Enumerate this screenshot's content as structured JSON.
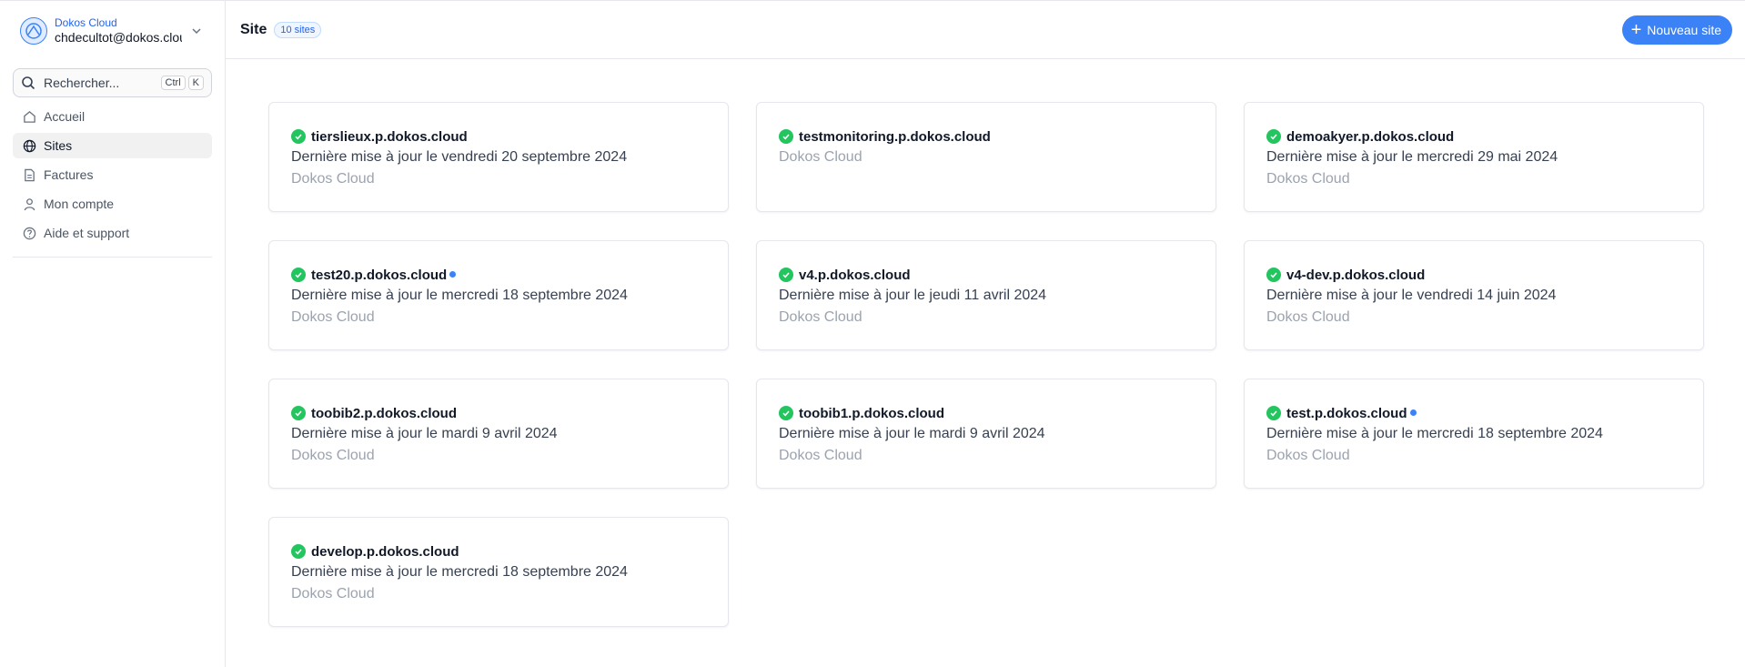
{
  "account": {
    "org": "Dokos Cloud",
    "email": "chdecultot@dokos.cloud"
  },
  "search": {
    "label": "Rechercher...",
    "kbd_ctrl": "Ctrl",
    "kbd_k": "K"
  },
  "nav": [
    {
      "label": "Accueil",
      "icon": "home-icon",
      "active": false
    },
    {
      "label": "Sites",
      "icon": "globe-icon",
      "active": true
    },
    {
      "label": "Factures",
      "icon": "file-icon",
      "active": false
    },
    {
      "label": "Mon compte",
      "icon": "user-icon",
      "active": false
    },
    {
      "label": "Aide et support",
      "icon": "help-icon",
      "active": false
    }
  ],
  "header": {
    "title": "Site",
    "count": "10 sites",
    "new_button": "Nouveau site"
  },
  "sites": [
    {
      "name": "tierslieux.p.dokos.cloud",
      "update": "Dernière mise à jour le vendredi 20 septembre 2024",
      "org": "Dokos Cloud",
      "dot": false
    },
    {
      "name": "testmonitoring.p.dokos.cloud",
      "update": "",
      "org": "Dokos Cloud",
      "dot": false
    },
    {
      "name": "demoakyer.p.dokos.cloud",
      "update": "Dernière mise à jour le mercredi 29 mai 2024",
      "org": "Dokos Cloud",
      "dot": false
    },
    {
      "name": "test20.p.dokos.cloud",
      "update": "Dernière mise à jour le mercredi 18 septembre 2024",
      "org": "Dokos Cloud",
      "dot": true
    },
    {
      "name": "v4.p.dokos.cloud",
      "update": "Dernière mise à jour le jeudi 11 avril 2024",
      "org": "Dokos Cloud",
      "dot": false
    },
    {
      "name": "v4-dev.p.dokos.cloud",
      "update": "Dernière mise à jour le vendredi 14 juin 2024",
      "org": "Dokos Cloud",
      "dot": false
    },
    {
      "name": "toobib2.p.dokos.cloud",
      "update": "Dernière mise à jour le mardi 9 avril 2024",
      "org": "Dokos Cloud",
      "dot": false
    },
    {
      "name": "toobib1.p.dokos.cloud",
      "update": "Dernière mise à jour le mardi 9 avril 2024",
      "org": "Dokos Cloud",
      "dot": false
    },
    {
      "name": "test.p.dokos.cloud",
      "update": "Dernière mise à jour le mercredi 18 septembre 2024",
      "org": "Dokos Cloud",
      "dot": true
    },
    {
      "name": "develop.p.dokos.cloud",
      "update": "Dernière mise à jour le mercredi 18 septembre 2024",
      "org": "Dokos Cloud",
      "dot": false
    }
  ],
  "colors": {
    "accent": "#3b82f6",
    "success": "#22c55e"
  }
}
